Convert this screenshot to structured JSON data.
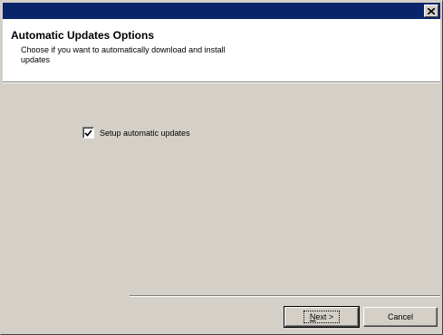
{
  "window": {
    "close_icon": "close-icon"
  },
  "header": {
    "title": "Automatic Updates Options",
    "subtitle": "Choose if you want to automatically download and install updates"
  },
  "options": {
    "setup_auto_updates_label": "Setup automatic updates",
    "setup_auto_updates_checked": true
  },
  "buttons": {
    "next_label": "Next >",
    "cancel_label": "Cancel"
  },
  "colors": {
    "titlebar": "#0a246a",
    "dialog_face": "#d4d0c8",
    "header_bg": "#ffffff"
  }
}
